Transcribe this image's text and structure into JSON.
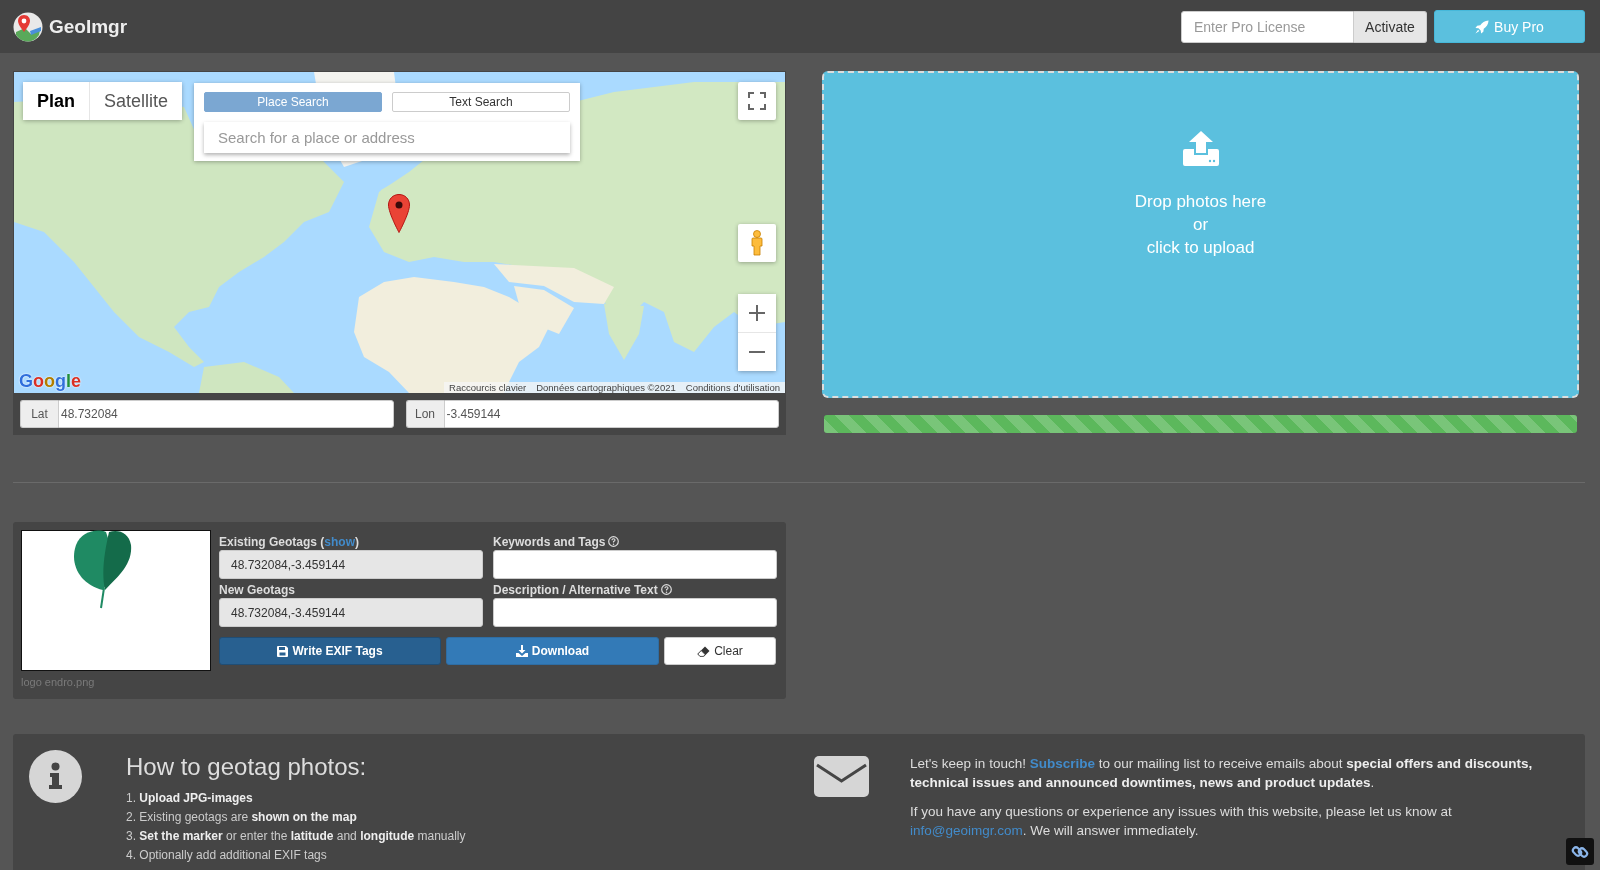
{
  "header": {
    "logo": "GeoImgr",
    "license_field": {
      "placeholder": "Enter Pro License"
    },
    "activate_button": "Activate",
    "buy_button": "Buy Pro"
  },
  "map": {
    "map_types": [
      {
        "label": "Plan",
        "selected": true
      },
      {
        "label": "Satellite",
        "selected": false
      }
    ],
    "search_modes": [
      {
        "label": "Place Search",
        "selected": true
      },
      {
        "label": "Text Search",
        "selected": false
      }
    ],
    "search_field": {
      "placeholder": "Search for a place or address"
    },
    "google_logo": "Google",
    "attribution": [
      "Raccourcis clavier",
      "Données cartographiques ©2021",
      "Conditions d'utilisation"
    ],
    "coordinates": [
      {
        "label": "Lat",
        "value": "48.732084"
      },
      {
        "label": "Lon",
        "value": "-3.459144"
      }
    ]
  },
  "upload": {
    "drop_zone": [
      "Drop photos here",
      "or",
      "click to upload"
    ],
    "progress": {
      "level": 1
    }
  },
  "photo_card": {
    "caption": "logo endro.png",
    "fields": [
      {
        "label": "Existing Geotags (",
        "link": "show",
        "label_end": ")",
        "help": false,
        "disabled": true,
        "value": "48.732084,-3.459144"
      },
      {
        "label": "Keywords and Tags",
        "help": true,
        "disabled": false
      },
      {
        "label": "New Geotags",
        "help": false,
        "disabled": true,
        "value": "48.732084,-3.459144"
      },
      {
        "label": "Description / Alternative Text",
        "help": true,
        "disabled": false
      }
    ],
    "buttons": [
      {
        "label": "Write EXIF Tags",
        "kind": "save"
      },
      {
        "label": "Download",
        "kind": "download"
      },
      {
        "label": "Clear",
        "kind": "clear"
      }
    ]
  },
  "howto": {
    "title": "How to geotag photos:",
    "steps": [
      "1. **Upload JPG-images**",
      "2. Existing geotags are **shown on the map**",
      "3. **Set the marker** or enter the **latitude** and **longitude** manually",
      "4. Optionally add additional EXIF tags"
    ]
  },
  "newsletter": {
    "paragraphs": [
      [
        {
          "kind": "text",
          "text": "Let's keep in touch! "
        },
        {
          "kind": "action-link",
          "text": "Subscribe"
        },
        {
          "kind": "text",
          "text": " to our mailing list to receive emails about **special offers and discounts, technical issues and announced downtimes, news and product updates**."
        }
      ],
      [
        {
          "kind": "text",
          "text": "If you have any questions or experience any issues with this website, please let us know at "
        },
        {
          "kind": "email-link",
          "text": "info@geoimgr.com"
        },
        {
          "kind": "text",
          "text": ". We will answer immediately."
        }
      ]
    ]
  }
}
